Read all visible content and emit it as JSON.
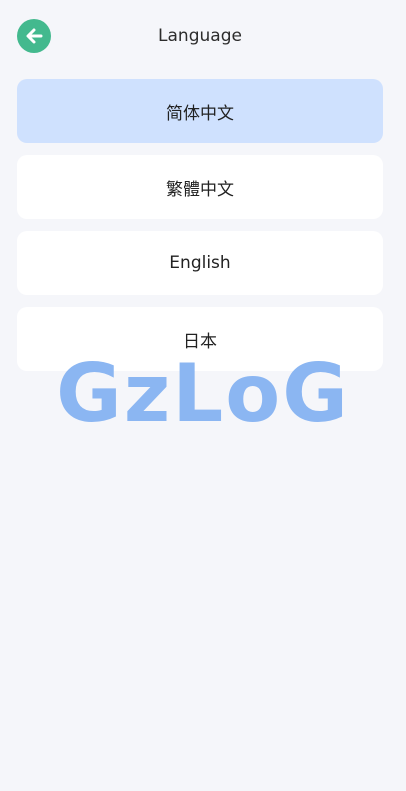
{
  "header": {
    "title": "Language",
    "back_icon": "arrow-left-icon",
    "accent_color": "#43b98e"
  },
  "languages": [
    {
      "label": "简体中文",
      "selected": true
    },
    {
      "label": "繁體中文",
      "selected": false
    },
    {
      "label": "English",
      "selected": false
    },
    {
      "label": "日本",
      "selected": false
    }
  ],
  "selected_color": "#cfe1fe",
  "watermark": {
    "text": "GzLoG",
    "color": "#8bb6f2"
  }
}
